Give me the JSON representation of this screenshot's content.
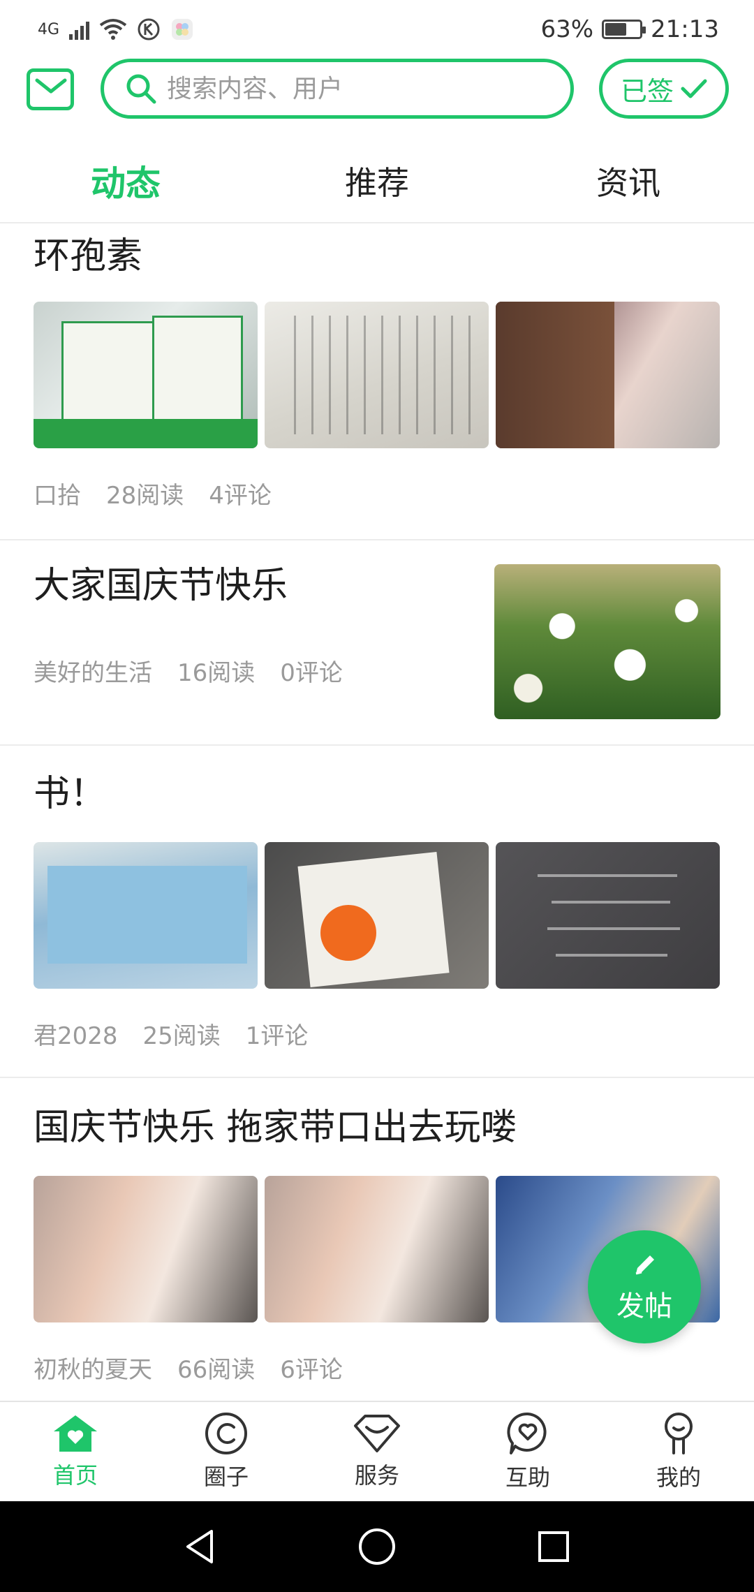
{
  "status_bar": {
    "network": "4G",
    "battery_percent": "63%",
    "battery_level": 0.63,
    "time": "21:13"
  },
  "header": {
    "search_placeholder": "搜索内容、用户",
    "signin_label": "已签"
  },
  "tabs": [
    {
      "label": "动态",
      "active": true
    },
    {
      "label": "推荐",
      "active": false
    },
    {
      "label": "资讯",
      "active": false
    }
  ],
  "posts": [
    {
      "title": "环孢素",
      "author": "口拾",
      "reads": "28阅读",
      "comments": "4评论"
    },
    {
      "title": "大家国庆节快乐",
      "author": "美好的生活",
      "reads": "16阅读",
      "comments": "0评论"
    },
    {
      "title": "书！",
      "author": "君2028",
      "reads": "25阅读",
      "comments": "1评论"
    },
    {
      "title": "国庆节快乐 拖家带口出去玩喽",
      "author": "初秋的夏天",
      "reads": "66阅读",
      "comments": "6评论"
    }
  ],
  "fab_label": "发帖",
  "bottom_nav": [
    {
      "label": "首页",
      "icon": "home-icon",
      "active": true
    },
    {
      "label": "圈子",
      "icon": "circle-icon",
      "active": false
    },
    {
      "label": "服务",
      "icon": "diamond-icon",
      "active": false
    },
    {
      "label": "互助",
      "icon": "heart-chat-icon",
      "active": false
    },
    {
      "label": "我的",
      "icon": "person-icon",
      "active": false
    }
  ],
  "colors": {
    "accent": "#1fc56a",
    "text": "#1e1e1e",
    "meta": "#9a9a9a"
  }
}
